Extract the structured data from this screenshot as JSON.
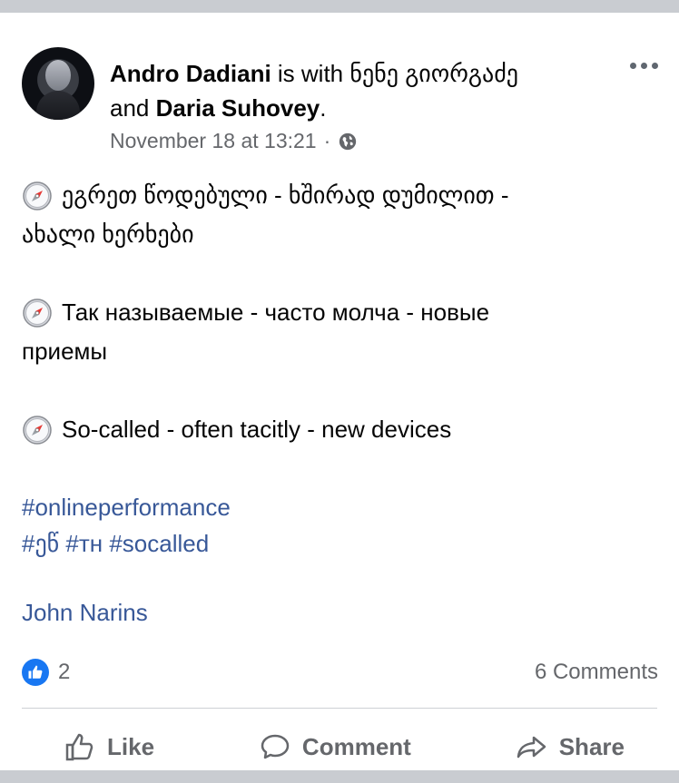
{
  "header": {
    "author": "Andro Dadiani",
    "with_text": "is with",
    "tagged_1": "ნენე გიორგაძე",
    "and_text": "and",
    "tagged_2": "Daria  Suhovey",
    "period": ".",
    "timestamp": "November 18 at 13:21",
    "dot": "·",
    "privacy_icon": "globe-icon",
    "more_icon": "more-options-icon"
  },
  "post": {
    "lines": [
      "ეგრეთ წოდებული - ხშირად დუმილით -",
      "ახალი ხერხები",
      "Так называемые - часто молча - новые",
      "приемы",
      "So-called - often tacitly - new devices"
    ],
    "line_icon": "compass-icon",
    "hashtags_line1": "#onlineperformance",
    "hashtags_line2": [
      "#ეწ",
      "#тн",
      "#socalled"
    ],
    "mention": "John Narins"
  },
  "stats": {
    "likes": "2",
    "comments": "6 Comments",
    "reaction_icon": "like-reaction-icon"
  },
  "actions": {
    "like": "Like",
    "comment": "Comment",
    "share": "Share"
  },
  "colors": {
    "link": "#385898",
    "muted": "#65676b",
    "reaction_blue": "#1877f2",
    "separator": "#c9ccd1"
  }
}
